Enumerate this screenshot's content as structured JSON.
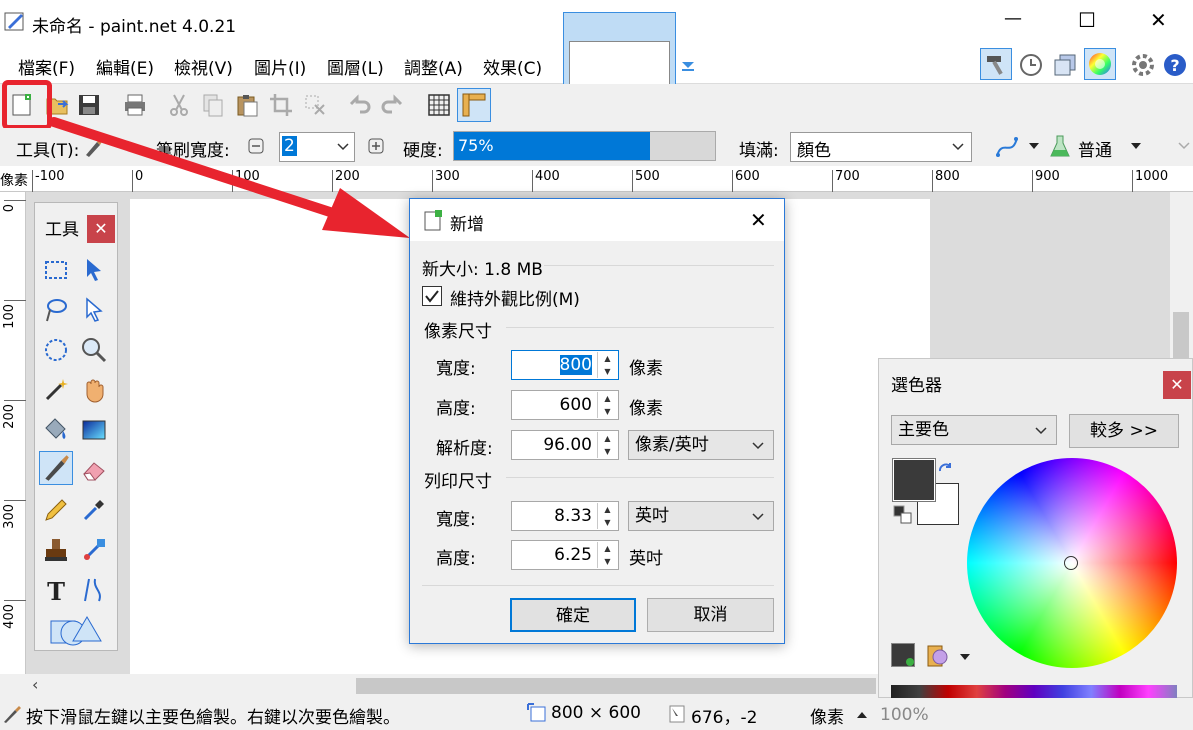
{
  "window": {
    "title": "未命名 - paint.net 4.0.21",
    "minimize": "—",
    "maximize": "☐",
    "close": "✕"
  },
  "menu": [
    "檔案(F)",
    "編輯(E)",
    "檢視(V)",
    "圖片(I)",
    "圖層(L)",
    "調整(A)",
    "效果(C)"
  ],
  "tool_options": {
    "tool_label": "工具(T):",
    "brush_width_label": "筆刷寬度:",
    "brush_width_value": "2",
    "hardness_label": "硬度:",
    "hardness_value": "75%",
    "hardness_fraction": 0.75,
    "fill_label": "填滿:",
    "fill_value": "顏色",
    "blend_value": "普通"
  },
  "ruler": {
    "unit": "像素",
    "h_ticks": [
      "-100",
      "0",
      "100",
      "200",
      "300",
      "400",
      "500",
      "600",
      "700",
      "800",
      "900",
      "1000"
    ],
    "v_ticks": [
      "0",
      "100",
      "200",
      "300",
      "400"
    ]
  },
  "tools_panel": {
    "title": "工具",
    "close": "✕"
  },
  "dialog": {
    "title": "新增",
    "close": "✕",
    "new_size": "新大小: 1.8 MB",
    "keep_aspect": "維持外觀比例(M)",
    "pixel_section": "像素尺寸",
    "width_label": "寬度:",
    "width_value": "800",
    "width_unit": "像素",
    "height_label": "高度:",
    "height_value": "600",
    "height_unit": "像素",
    "resolution_label": "解析度:",
    "resolution_value": "96.00",
    "resolution_unit": "像素/英吋",
    "print_section": "列印尺寸",
    "print_width_label": "寬度:",
    "print_width_value": "8.33",
    "print_width_unit": "英吋",
    "print_height_label": "高度:",
    "print_height_value": "6.25",
    "print_height_unit": "英吋",
    "ok": "確定",
    "cancel": "取消"
  },
  "color_picker": {
    "title": "選色器",
    "close": "✕",
    "mode": "主要色",
    "more": "較多 >>",
    "primary_color": "#3a3a3a",
    "secondary_color": "#ffffff"
  },
  "status": {
    "hint": "按下滑鼠左鍵以主要色繪製。右鍵以次要色繪製。",
    "size": "800 × 600",
    "cursor": "676，-2",
    "unit": "像素",
    "zoom": "100%"
  },
  "colors": {
    "accent": "#0078d7",
    "highlight_red": "#e8242e"
  }
}
